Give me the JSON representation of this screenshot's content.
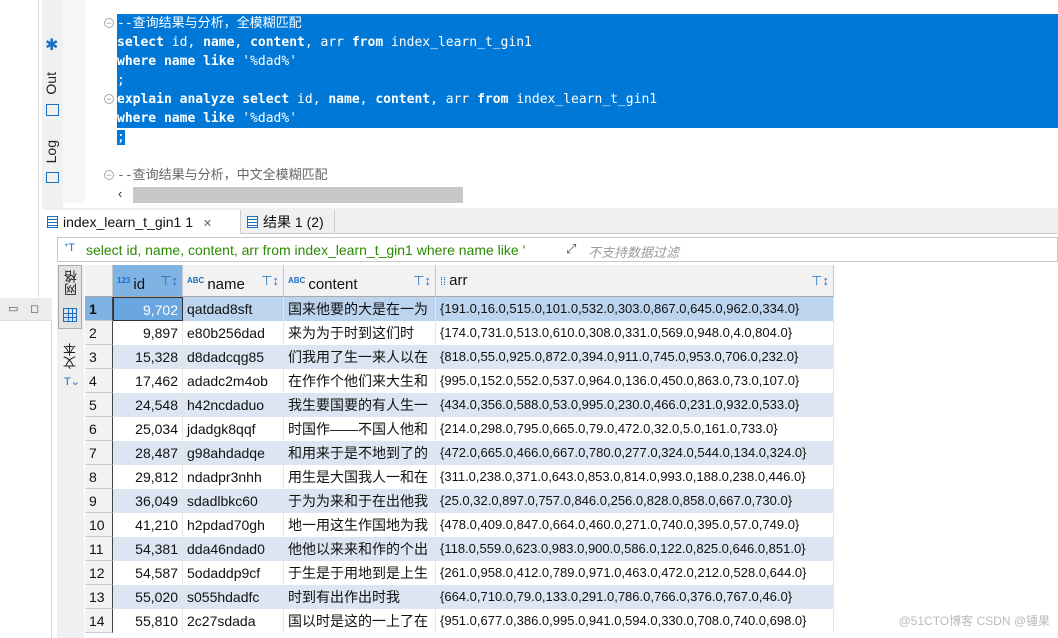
{
  "side_toolbar": {
    "out_label": "Out",
    "log_label": "Log"
  },
  "editor": {
    "lines": [
      {
        "fold": true,
        "sel": true,
        "tokens": [
          {
            "t": "--查询结果与分析，全模糊匹配",
            "c": ""
          }
        ]
      },
      {
        "fold": false,
        "sel": true,
        "tokens": [
          {
            "t": "select",
            "c": "kw"
          },
          {
            "t": " id, ",
            "c": ""
          },
          {
            "t": "name",
            "c": "kw"
          },
          {
            "t": ", ",
            "c": ""
          },
          {
            "t": "content",
            "c": "kw"
          },
          {
            "t": ", arr ",
            "c": ""
          },
          {
            "t": "from",
            "c": "kw"
          },
          {
            "t": " index_learn_t_gin1",
            "c": ""
          }
        ]
      },
      {
        "fold": false,
        "sel": true,
        "tokens": [
          {
            "t": "where",
            "c": "kw"
          },
          {
            "t": " ",
            "c": ""
          },
          {
            "t": "name",
            "c": "kw"
          },
          {
            "t": " ",
            "c": ""
          },
          {
            "t": "like",
            "c": "kw"
          },
          {
            "t": " '%dad%'",
            "c": ""
          }
        ]
      },
      {
        "fold": false,
        "sel": true,
        "tokens": [
          {
            "t": ";",
            "c": ""
          }
        ]
      },
      {
        "fold": true,
        "sel": true,
        "tokens": [
          {
            "t": "explain",
            "c": "kw"
          },
          {
            "t": " ",
            "c": ""
          },
          {
            "t": "analyze",
            "c": "kw"
          },
          {
            "t": " ",
            "c": ""
          },
          {
            "t": "select",
            "c": "kw"
          },
          {
            "t": " id, ",
            "c": ""
          },
          {
            "t": "name",
            "c": "kw"
          },
          {
            "t": ", ",
            "c": ""
          },
          {
            "t": "content",
            "c": "kw"
          },
          {
            "t": ", arr ",
            "c": ""
          },
          {
            "t": "from",
            "c": "kw"
          },
          {
            "t": " index_learn_t_gin1",
            "c": ""
          }
        ]
      },
      {
        "fold": false,
        "sel": true,
        "tokens": [
          {
            "t": "where",
            "c": "kw"
          },
          {
            "t": " ",
            "c": ""
          },
          {
            "t": "name",
            "c": "kw"
          },
          {
            "t": " ",
            "c": ""
          },
          {
            "t": "like",
            "c": "kw"
          },
          {
            "t": " '%dad%'",
            "c": ""
          }
        ]
      },
      {
        "fold": false,
        "sel": "partial",
        "tokens": [
          {
            "t": ";",
            "c": ""
          }
        ]
      },
      {
        "fold": false,
        "sel": false,
        "tokens": []
      },
      {
        "fold": true,
        "sel": false,
        "tokens": [
          {
            "t": "--查询结果与分析，中文全模糊匹配",
            "c": "cm"
          }
        ]
      }
    ],
    "selection_color": "#0078d7"
  },
  "results": {
    "tabs": [
      {
        "label": "index_learn_t_gin1 1",
        "active": true,
        "closable": true
      },
      {
        "label": "结果 1 (2)",
        "active": false
      }
    ],
    "filter_query": "select id, name, content, arr from index_learn_t_gin1 where name like '",
    "filter_placeholder": "不支持数据过滤",
    "side_tabs": {
      "grid": "网格",
      "text": "文本"
    },
    "columns": [
      {
        "label": "id",
        "type": "123"
      },
      {
        "label": "name",
        "type": "ABC"
      },
      {
        "label": "content",
        "type": "ABC"
      },
      {
        "label": "arr",
        "type": "array"
      }
    ],
    "rows": [
      [
        "1",
        "9,702",
        "qatdad8sft",
        "国来他要的大是在一为",
        "{191.0,16.0,515.0,101.0,532.0,303.0,867.0,645.0,962.0,334.0}"
      ],
      [
        "2",
        "9,897",
        "e80b256dad",
        "来为为于时到这们时",
        "{174.0,731.0,513.0,610.0,308.0,331.0,569.0,948.0,4.0,804.0}"
      ],
      [
        "3",
        "15,328",
        "d8dadcqg85",
        "们我用了生一来人以在",
        "{818.0,55.0,925.0,872.0,394.0,911.0,745.0,953.0,706.0,232.0}"
      ],
      [
        "4",
        "17,462",
        "adadc2m4ob",
        "在作作个他们来大生和",
        "{995.0,152.0,552.0,537.0,964.0,136.0,450.0,863.0,73.0,107.0}"
      ],
      [
        "5",
        "24,548",
        "h42ncdaduo",
        "我生要国要的有人生一",
        "{434.0,356.0,588.0,53.0,995.0,230.0,466.0,231.0,932.0,533.0}"
      ],
      [
        "6",
        "25,034",
        "jdadgk8qqf",
        "时国作——不国人他和",
        "{214.0,298.0,795.0,665.0,79.0,472.0,32.0,5.0,161.0,733.0}"
      ],
      [
        "7",
        "28,487",
        "g98ahdadqe",
        "和用来于是不地到了的",
        "{472.0,665.0,466.0,667.0,780.0,277.0,324.0,544.0,134.0,324.0}"
      ],
      [
        "8",
        "29,812",
        "ndadpr3nhh",
        "用生是大国我人一和在",
        "{311.0,238.0,371.0,643.0,853.0,814.0,993.0,188.0,238.0,446.0}"
      ],
      [
        "9",
        "36,049",
        "sdadlbkc60",
        "于为为来和于在出他我",
        "{25.0,32.0,897.0,757.0,846.0,256.0,828.0,858.0,667.0,730.0}"
      ],
      [
        "10",
        "41,210",
        "h2pdad70gh",
        "地一用这生作国地为我",
        "{478.0,409.0,847.0,664.0,460.0,271.0,740.0,395.0,57.0,749.0}"
      ],
      [
        "11",
        "54,381",
        "dda46ndad0",
        "他他以来来和作的个出",
        "{118.0,559.0,623.0,983.0,900.0,586.0,122.0,825.0,646.0,851.0}"
      ],
      [
        "12",
        "54,587",
        "5odaddp9cf",
        "于生是于用地到是上生",
        "{261.0,958.0,412.0,789.0,971.0,463.0,472.0,212.0,528.0,644.0}"
      ],
      [
        "13",
        "55,020",
        "s055hdadfc",
        "时到有出作出时我",
        "{664.0,710.0,79.0,133.0,291.0,786.0,766.0,376.0,767.0,46.0}"
      ],
      [
        "14",
        "55,810",
        "2c27sdada",
        "国以时是这的一上了在",
        "{951.0,677.0,386.0,995.0,941.0,594.0,330.0,708.0,740.0,698.0}"
      ]
    ]
  },
  "watermark": "@51CTO博客 CSDN @锺果"
}
